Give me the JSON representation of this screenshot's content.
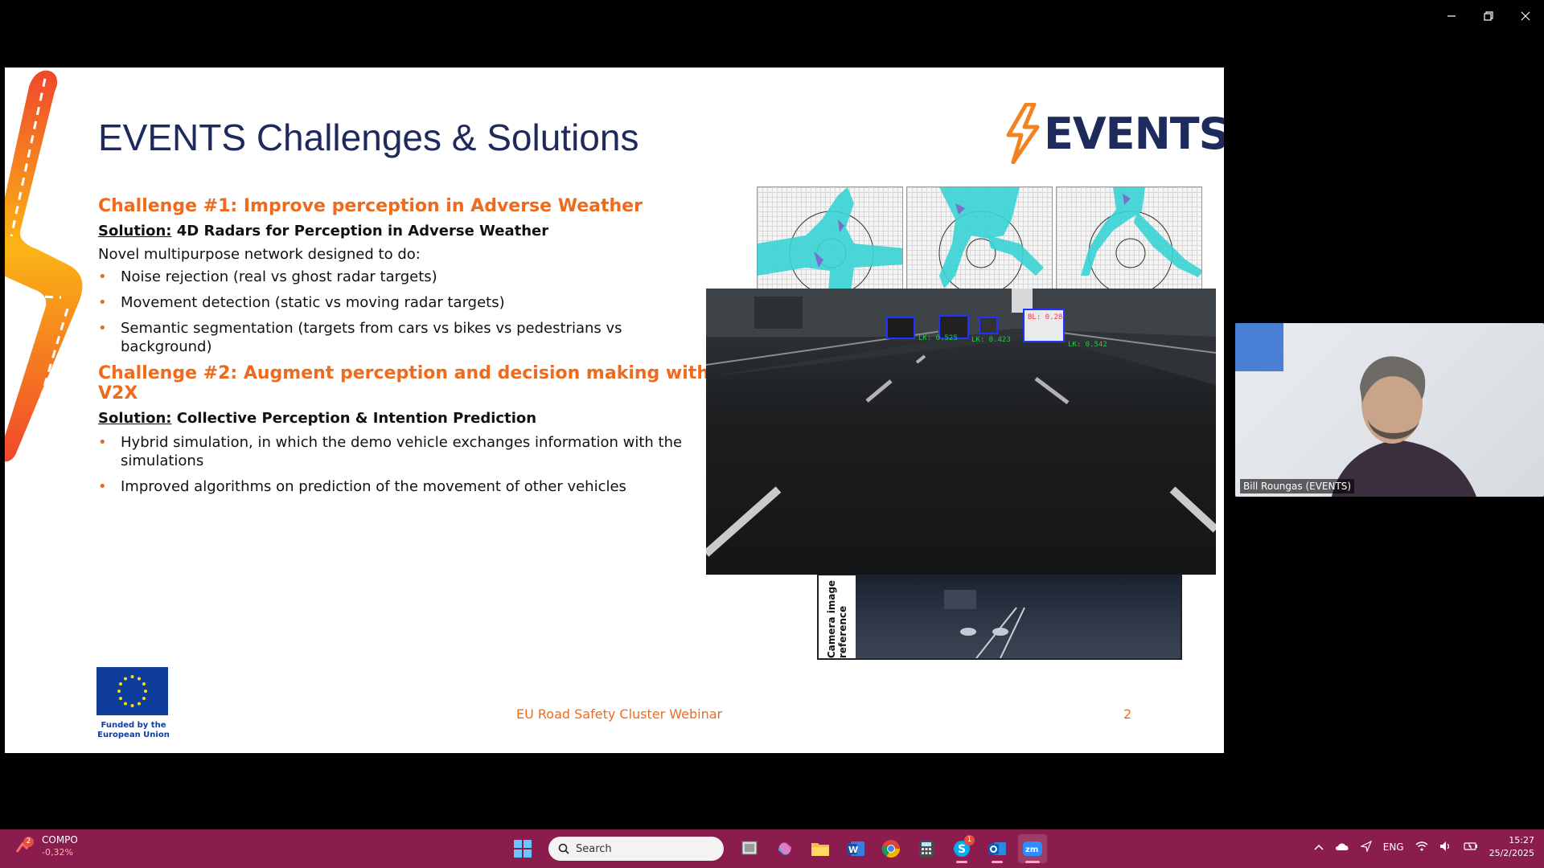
{
  "window": {
    "minimize_icon": "minimize-icon",
    "restore_icon": "restore-icon",
    "close_icon": "close-icon"
  },
  "slide": {
    "title": "EVENTS Challenges & Solutions",
    "logo_text": "EVENTS",
    "challenge1": {
      "heading": "Challenge #1: Improve perception in Adverse Weather",
      "solution_label": "Solution:",
      "solution_text": " 4D Radars for Perception in Adverse Weather",
      "intro": "Novel multipurpose network designed to do:",
      "bullets": [
        "Noise rejection (real vs ghost radar targets)",
        "Movement detection (static vs moving radar targets)",
        "Semantic segmentation (targets from cars vs bikes vs pedestrians vs background)"
      ]
    },
    "challenge2": {
      "heading": "Challenge #2: Augment perception and decision making with V2X",
      "solution_label": "Solution:",
      "solution_text": " Collective Perception & Intention Prediction",
      "bullets": [
        "Hybrid simulation, in which the demo vehicle exchanges information with the simulations",
        "Improved algorithms on prediction of the movement of other vehicles"
      ]
    },
    "camera_label": "Camera image reference",
    "eu_text": "Funded by the European Union",
    "footer": "EU Road Safety Cluster Webinar",
    "page_number": "2",
    "accent_color": "#f06a1b",
    "title_color": "#1f2a5c"
  },
  "participant": {
    "name": "Bill Roungas (EVENTS)"
  },
  "taskbar": {
    "stock_name": "COMPO",
    "stock_change": "-0,32%",
    "stock_badge": "2",
    "search_placeholder": "Search",
    "skype_badge": "1",
    "language": "ENG",
    "time": "15:27",
    "date": "25/2/2025",
    "color": "#8b1c4e"
  }
}
